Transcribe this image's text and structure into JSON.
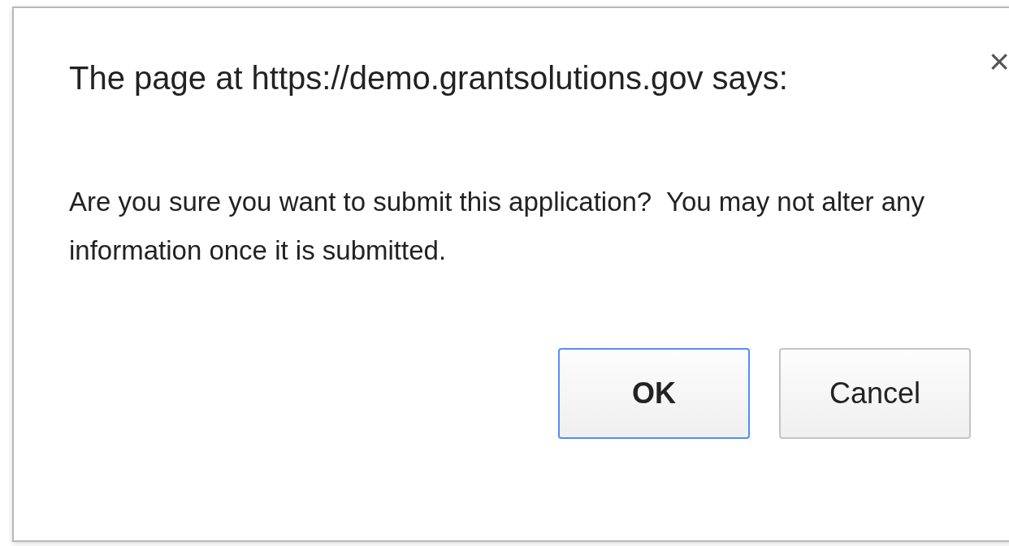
{
  "dialog": {
    "title": "The page at https://demo.grantsolutions.gov says:",
    "close": "×",
    "message": "Are you sure you want to submit this application?  You may not alter any information once it is submitted.",
    "buttons": [
      {
        "label": "OK",
        "default": true
      },
      {
        "label": "Cancel",
        "default": false
      }
    ]
  }
}
